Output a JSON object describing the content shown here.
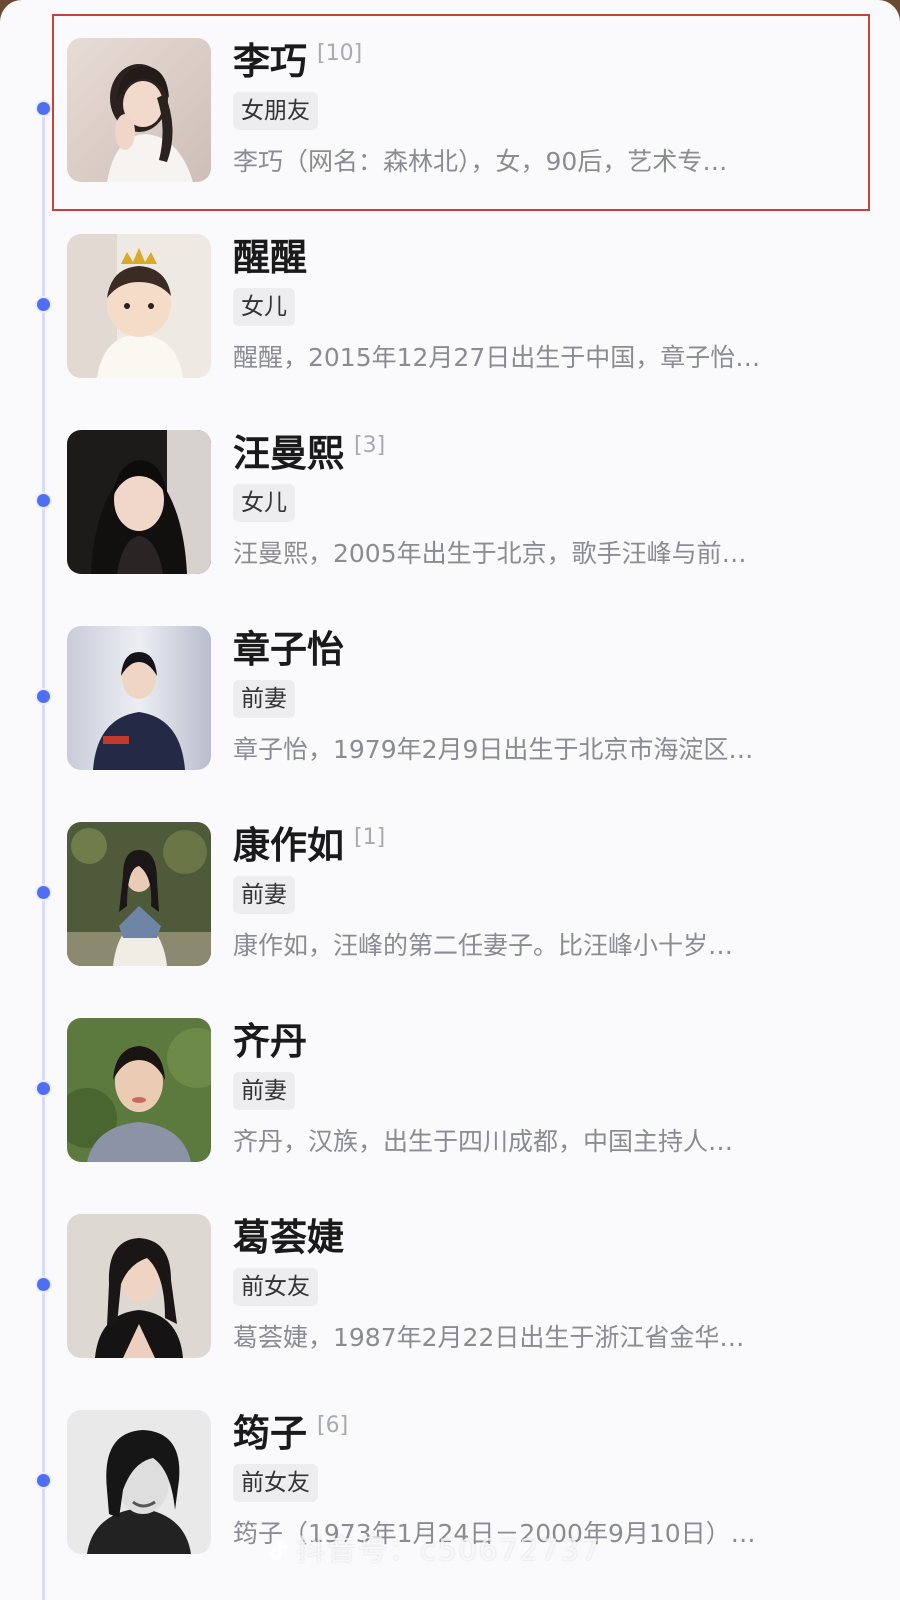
{
  "list": [
    {
      "name": "李巧",
      "ref": "[10]",
      "tag": "女朋友",
      "desc": "李巧（网名：森林北），女，90后，艺术专…",
      "avatar": "woman-portrait-white-blouse"
    },
    {
      "name": "醒醒",
      "ref": "",
      "tag": "女儿",
      "desc": "醒醒，2015年12月27日出生于中国，章子怡…",
      "avatar": "baby-with-crown"
    },
    {
      "name": "汪曼熙",
      "ref": "[3]",
      "tag": "女儿",
      "desc": "汪曼熙，2005年出生于北京，歌手汪峰与前…",
      "avatar": "young-woman-long-hair"
    },
    {
      "name": "章子怡",
      "ref": "",
      "tag": "前妻",
      "desc": "章子怡，1979年2月9日出生于北京市海淀区…",
      "avatar": "woman-navy-dress"
    },
    {
      "name": "康作如",
      "ref": "[1]",
      "tag": "前妻",
      "desc": "康作如，汪峰的第二任妻子。比汪峰小十岁…",
      "avatar": "woman-outdoor-dress"
    },
    {
      "name": "齐丹",
      "ref": "",
      "tag": "前妻",
      "desc": "齐丹，汉族，出生于四川成都，中国主持人…",
      "avatar": "woman-green-background"
    },
    {
      "name": "葛荟婕",
      "ref": "",
      "tag": "前女友",
      "desc": "葛荟婕，1987年2月22日出生于浙江省金华…",
      "avatar": "woman-black-top"
    },
    {
      "name": "筠子",
      "ref": "[6]",
      "tag": "前女友",
      "desc": "筠子（1973年1月24日－2000年9月10日）…",
      "avatar": "woman-black-white-photo"
    }
  ],
  "watermark": "抖音号：c50672737"
}
